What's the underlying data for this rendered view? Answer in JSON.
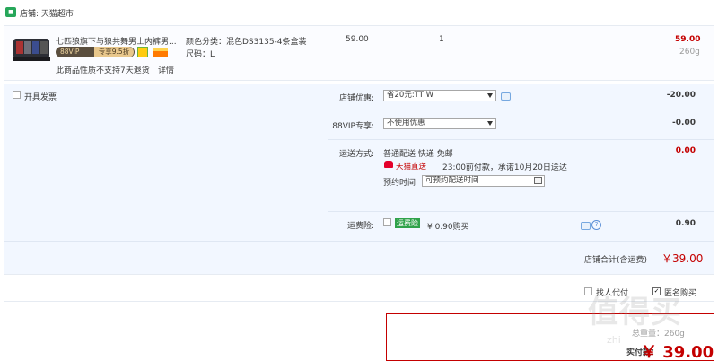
{
  "shop": {
    "icon": "shop-icon",
    "label": "店铺: 天猫超市"
  },
  "item": {
    "title": "七匹狼旗下与狼共舞男士内裤男...",
    "vip_label": "88VIP",
    "vip_discount": "专享9.5折",
    "notice": "此商品性质不支持7天退货",
    "notice_link": "详情",
    "spec_color": "颜色分类：混色DS3135-4条盒装",
    "spec_size": "尺码：L",
    "price": "59.00",
    "quantity": "1",
    "subtotal": "59.00",
    "weight": "260g"
  },
  "invoice": {
    "label": "开具发票"
  },
  "coupon": {
    "label": "店铺优惠:",
    "selected": "省20元:TT W",
    "amount": "-20.00"
  },
  "vip": {
    "label": "88VIP专享:",
    "selected": "不使用优惠",
    "amount": "-0.00"
  },
  "shipping": {
    "label": "运送方式:",
    "method": "普通配送 快递 免邮",
    "direct_badge": "天猫直送",
    "promise": "23:00前付款，承诺10月20日送达",
    "schedule_label": "预约时间",
    "schedule_placeholder": "可预约配送时间",
    "amount": "0.00"
  },
  "insurance": {
    "label": "运费险:",
    "badge": "运费险",
    "price": "¥ 0.90购买",
    "help": "?",
    "amount": "0.90"
  },
  "store_total": {
    "label": "店铺合计(含运费)",
    "value": "￥39.00"
  },
  "options": {
    "proxy_label": "找人代付",
    "anonymous_label": "匿名购买"
  },
  "payment": {
    "weight_label": "总重量：260g",
    "label": "实付款：",
    "value": "￥ 39.00"
  },
  "watermark": {
    "text": "值得买",
    "sub": "zhi"
  },
  "colors": {
    "accent": "#c40000",
    "panel": "#f2f7ff",
    "shop_icon": "#27a75a",
    "insurance_badge": "#2fa24a"
  }
}
